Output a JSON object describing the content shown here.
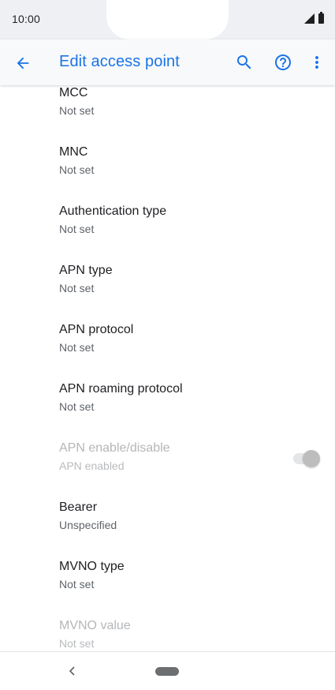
{
  "status_bar": {
    "time": "10:00",
    "icons": [
      "signal-icon",
      "battery-icon"
    ]
  },
  "app_bar": {
    "title": "Edit access point",
    "accent_color": "#1a73e8",
    "icons": [
      "back-arrow-icon",
      "search-icon",
      "help-icon",
      "more-vert-icon"
    ]
  },
  "settings": [
    {
      "title": "MCC",
      "subtitle": "Not set",
      "enabled": true
    },
    {
      "title": "MNC",
      "subtitle": "Not set",
      "enabled": true
    },
    {
      "title": "Authentication type",
      "subtitle": "Not set",
      "enabled": true
    },
    {
      "title": "APN type",
      "subtitle": "Not set",
      "enabled": true
    },
    {
      "title": "APN protocol",
      "subtitle": "Not set",
      "enabled": true
    },
    {
      "title": "APN roaming protocol",
      "subtitle": "Not set",
      "enabled": true
    },
    {
      "title": "APN enable/disable",
      "subtitle": "APN enabled",
      "enabled": false,
      "toggle_on": true
    },
    {
      "title": "Bearer",
      "subtitle": "Unspecified",
      "enabled": true
    },
    {
      "title": "MVNO type",
      "subtitle": "Not set",
      "enabled": true
    },
    {
      "title": "MVNO value",
      "subtitle": "Not set",
      "enabled": false
    }
  ],
  "nav_bar": {
    "icons": [
      "nav-back-icon",
      "home-pill-icon"
    ]
  }
}
